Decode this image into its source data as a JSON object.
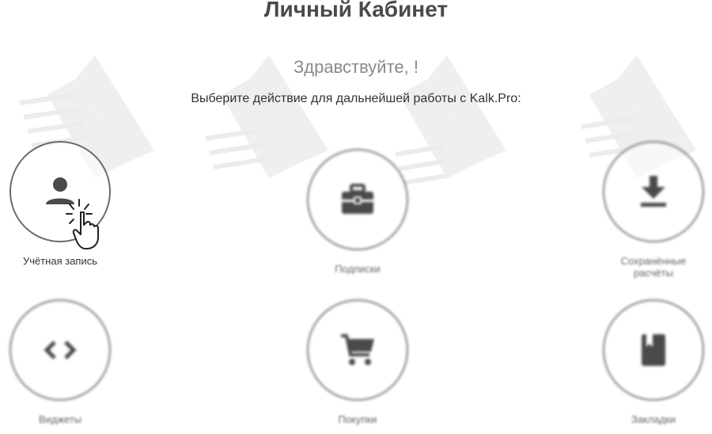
{
  "page": {
    "title": "Личный Кабинет",
    "greeting": "Здравствуйте, !",
    "subtitle": "Выберите действие для дальнейшей работы с Kalk.Pro:"
  },
  "tiles": [
    {
      "label": "Учётная запись",
      "icon": "user-icon"
    },
    {
      "label": "Подписки",
      "icon": "briefcase-icon"
    },
    {
      "label": "Сохранённые расчёты",
      "icon": "download-icon"
    },
    {
      "label": "Виджеты",
      "icon": "code-icon"
    },
    {
      "label": "Покупки",
      "icon": "cart-icon"
    },
    {
      "label": "Закладки",
      "icon": "bookmark-icon"
    }
  ],
  "colors": {
    "icon": "#4a4a4a",
    "circle_border": "#6b6b6b",
    "watermark": "#ebebeb"
  }
}
